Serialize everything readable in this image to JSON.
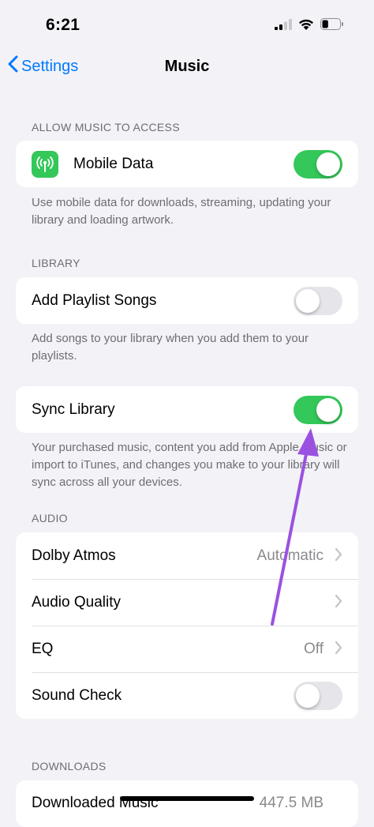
{
  "status_bar": {
    "time": "6:21",
    "battery_level": 0.35
  },
  "nav": {
    "back_label": "Settings",
    "title": "Music"
  },
  "sections": {
    "allow_access": {
      "header": "ALLOW MUSIC TO ACCESS",
      "mobile_data_label": "Mobile Data",
      "mobile_data_on": true,
      "footer": "Use mobile data for downloads, streaming, updating your library and loading artwork."
    },
    "library": {
      "header": "LIBRARY",
      "add_playlist_label": "Add Playlist Songs",
      "add_playlist_on": false,
      "add_playlist_footer": "Add songs to your library when you add them to your playlists.",
      "sync_label": "Sync Library",
      "sync_on": true,
      "sync_footer": "Your purchased music, content you add from Apple Music or import to iTunes, and changes you make to your library will sync across all your devices."
    },
    "audio": {
      "header": "AUDIO",
      "dolby_label": "Dolby Atmos",
      "dolby_value": "Automatic",
      "quality_label": "Audio Quality",
      "eq_label": "EQ",
      "eq_value": "Off",
      "sound_check_label": "Sound Check",
      "sound_check_on": false
    },
    "downloads": {
      "header": "DOWNLOADS",
      "downloaded_label": "Downloaded Music",
      "downloaded_value": "447.5 MB"
    }
  },
  "colors": {
    "accent": "#007aff",
    "toggle_on": "#34c759",
    "annotation_arrow": "#9b51e0"
  }
}
